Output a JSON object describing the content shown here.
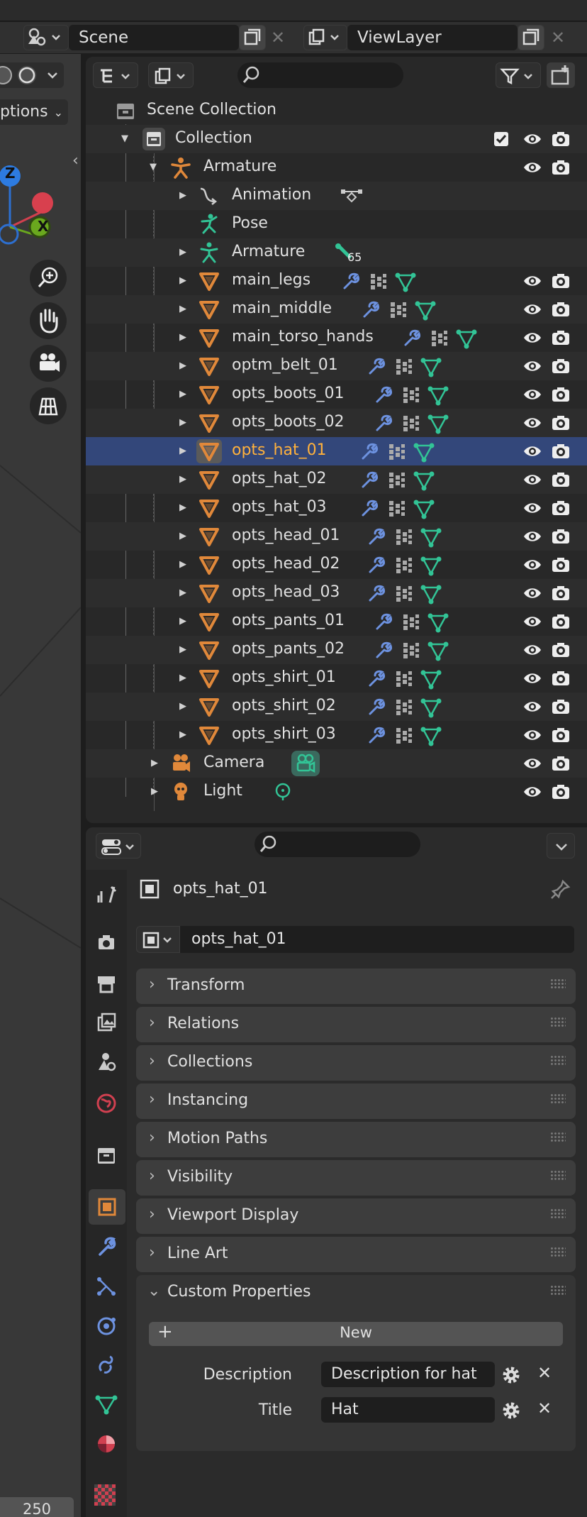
{
  "header": {
    "scene_label": "Scene",
    "viewlayer_label": "ViewLayer"
  },
  "viewport": {
    "options_label": "ptions",
    "frame_value": "250",
    "axis_z": "Z",
    "axis_x": "X"
  },
  "outliner": {
    "scene_collection": "Scene Collection",
    "collection": "Collection",
    "armature_obj": "Armature",
    "animation": "Animation",
    "pose": "Pose",
    "armature_data": "Armature",
    "bone_count": "65",
    "meshes": [
      "main_legs",
      "main_middle",
      "main_torso_hands",
      "optm_belt_01",
      "opts_boots_01",
      "opts_boots_02",
      "opts_hat_01",
      "opts_hat_02",
      "opts_hat_03",
      "opts_head_01",
      "opts_head_02",
      "opts_head_03",
      "opts_pants_01",
      "opts_pants_02",
      "opts_shirt_01",
      "opts_shirt_02",
      "opts_shirt_03"
    ],
    "selected": "opts_hat_01",
    "camera": "Camera",
    "light": "Light"
  },
  "properties": {
    "object_name": "opts_hat_01",
    "name_field": "opts_hat_01",
    "panels": [
      "Transform",
      "Relations",
      "Collections",
      "Instancing",
      "Motion Paths",
      "Visibility",
      "Viewport Display",
      "Line Art"
    ],
    "custom_panel": "Custom Properties",
    "new_button": "New",
    "custom_props": [
      {
        "key": "Description",
        "value": "Description for hat"
      },
      {
        "key": "Title",
        "value": "Hat"
      }
    ]
  },
  "colors": {
    "selection": "#33477a",
    "highlight_text": "#ffb13c",
    "mesh_icon": "#e0883a",
    "modifier_icon": "#6d92e0",
    "data_icon": "#32c496"
  }
}
